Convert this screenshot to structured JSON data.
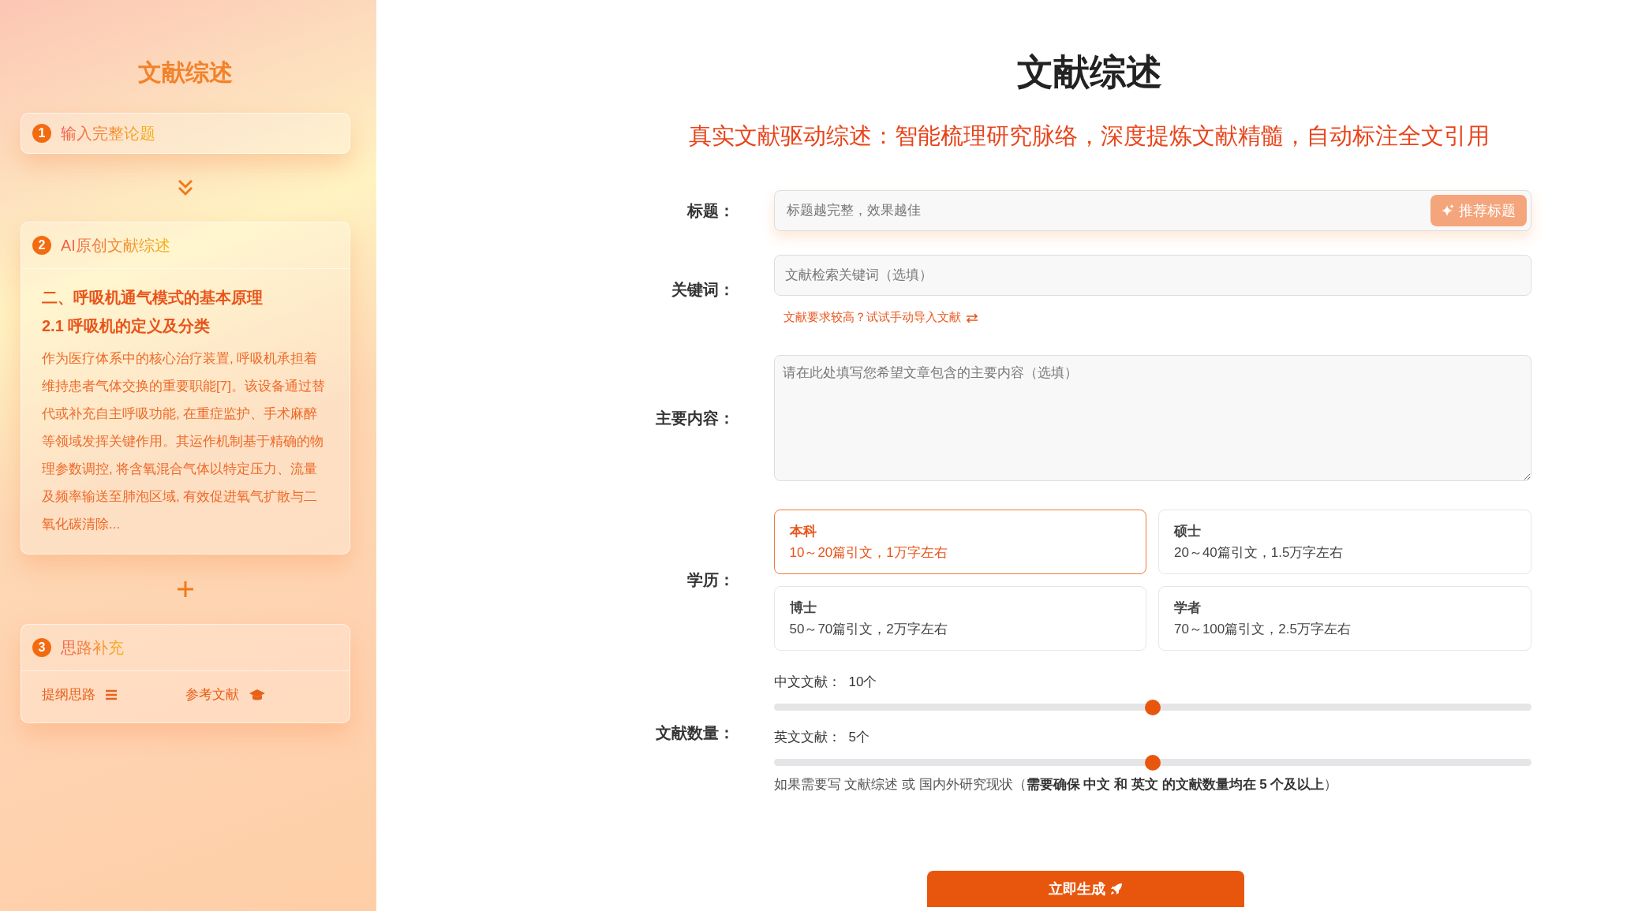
{
  "sidebar": {
    "title": "文献综述",
    "steps": [
      {
        "number": "1",
        "title": "输入完整论题"
      },
      {
        "number": "2",
        "title": "AI原创文献综述",
        "preview": {
          "headings": [
            "二、呼吸机通气模式的基本原理",
            "2.1 呼吸机的定义及分类"
          ],
          "body": "作为医疗体系中的核心治疗装置, 呼吸机承担着维持患者气体交换的重要职能[7]。该设备通过替代或补充自主呼吸功能, 在重症监护、手术麻醉等领域发挥关键作用。其运作机制基于精确的物理参数调控, 将含氧混合气体以特定压力、流量及频率输送至肺泡区域, 有效促进氧气扩散与二氧化碳清除..."
        }
      },
      {
        "number": "3",
        "title": "思路补充",
        "actions": [
          {
            "label": "提纲思路"
          },
          {
            "label": "参考文献"
          }
        ]
      }
    ]
  },
  "main": {
    "title": "文献综述",
    "subtitle": "真实文献驱动综述：智能梳理研究脉络，深度提炼文献精髓，自动标注全文引用",
    "title_field": {
      "label": "标题：",
      "placeholder": "标题越完整，效果越佳",
      "button": "推荐标题"
    },
    "keywords_field": {
      "label": "关键词：",
      "placeholder": "文献检索关键词（选填）",
      "link": "文献要求较高？试试手动导入文献"
    },
    "content_field": {
      "label": "主要内容：",
      "placeholder": "请在此处填写您希望文章包含的主要内容（选填）"
    },
    "education": {
      "label": "学历：",
      "options": [
        {
          "name": "本科",
          "detail": "10～20篇引文，1万字左右",
          "selected": true
        },
        {
          "name": "硕士",
          "detail": "20～40篇引文，1.5万字左右",
          "selected": false
        },
        {
          "name": "博士",
          "detail": "50～70篇引文，2万字左右",
          "selected": false
        },
        {
          "name": "学者",
          "detail": "70～100篇引文，2.5万字左右",
          "selected": false
        }
      ]
    },
    "counts": {
      "label": "文献数量：",
      "sliders": [
        {
          "name": "中文文献：",
          "reading": "10个",
          "level": 0.5
        },
        {
          "name": "英文文献：",
          "reading": "5个",
          "level": 0.5
        }
      ],
      "note": "如果需要写 文献综述 或 国内外研究现状（**需要确保 中文 和 英文 的文献数量均在 5 个及以上**）"
    },
    "submit": "立即生成"
  }
}
